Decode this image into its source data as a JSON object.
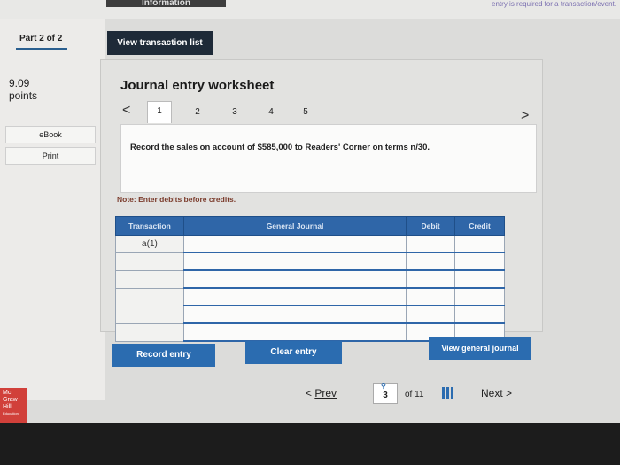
{
  "top": {
    "tab_label": "Information",
    "message": "entry is required for a transaction/event."
  },
  "left": {
    "part_label": "Part 2 of 2",
    "points_value": "9.09",
    "points_label": "points",
    "ebook_label": "eBook",
    "print_label": "Print"
  },
  "header": {
    "view_transaction_list": "View transaction list"
  },
  "worksheet": {
    "title": "Journal entry worksheet",
    "prev_arrow": "<",
    "next_arrow": ">",
    "pages": [
      "1",
      "2",
      "3",
      "4",
      "5"
    ],
    "active_page": "1",
    "instruction": "Record the sales on account of $585,000 to Readers' Corner on terms n/30.",
    "note": "Note: Enter debits before credits.",
    "table": {
      "headers": [
        "Transaction",
        "General Journal",
        "Debit",
        "Credit"
      ],
      "rows": [
        [
          "a(1)",
          "",
          "",
          ""
        ],
        [
          "",
          "",
          "",
          ""
        ],
        [
          "",
          "",
          "",
          ""
        ],
        [
          "",
          "",
          "",
          ""
        ],
        [
          "",
          "",
          "",
          ""
        ],
        [
          "",
          "",
          "",
          ""
        ]
      ]
    },
    "buttons": {
      "record_entry": "Record entry",
      "clear_entry": "Clear entry",
      "view_general_journal": "View general journal"
    }
  },
  "footer": {
    "prev_label": "Prev",
    "current_page": "3",
    "total_label": "of 11",
    "next_label": "Next",
    "logo_lines": [
      "Mc",
      "Graw",
      "Hill",
      "Education"
    ]
  },
  "colors": {
    "primary_button": "#2b6cb0",
    "dark_button": "#1e2a38",
    "table_header": "#2f66a8",
    "logo": "#d1403a"
  }
}
